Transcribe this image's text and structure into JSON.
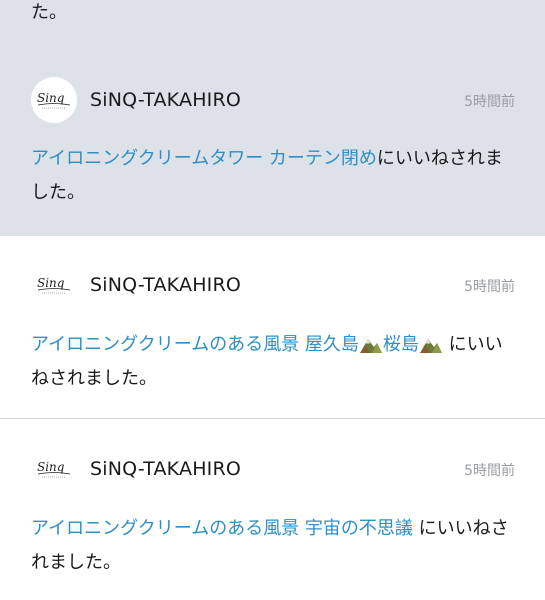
{
  "colors": {
    "unread_background": "#dde1e8",
    "read_background": "#ffffff",
    "link": "#2d8fc6",
    "timestamp": "#9a9da3",
    "divider": "#d3d6db"
  },
  "top_fragment": "た。",
  "notifications": [
    {
      "state": "unread",
      "avatar_icon": "sinq-logo-icon",
      "username": "SiNQ-TAKAHIRO",
      "time": "5時間前",
      "article_title": "アイロニングクリームタワー カーテン閉め",
      "action_text": "にいいねされました。"
    },
    {
      "state": "read",
      "avatar_icon": "sinq-logo-icon",
      "username": "SiNQ-TAKAHIRO",
      "time": "5時間前",
      "article_title_part1": "アイロニングクリームのある風景 屋久島",
      "article_title_part2": "桜島",
      "title_icon": "mountain-emoji-icon",
      "action_text": "にいいねされました。"
    },
    {
      "state": "read",
      "avatar_icon": "sinq-logo-icon",
      "username": "SiNQ-TAKAHIRO",
      "time": "5時間前",
      "article_title": "アイロニングクリームのある風景 宇宙の不思議",
      "action_text": "にいいねされました。"
    }
  ]
}
